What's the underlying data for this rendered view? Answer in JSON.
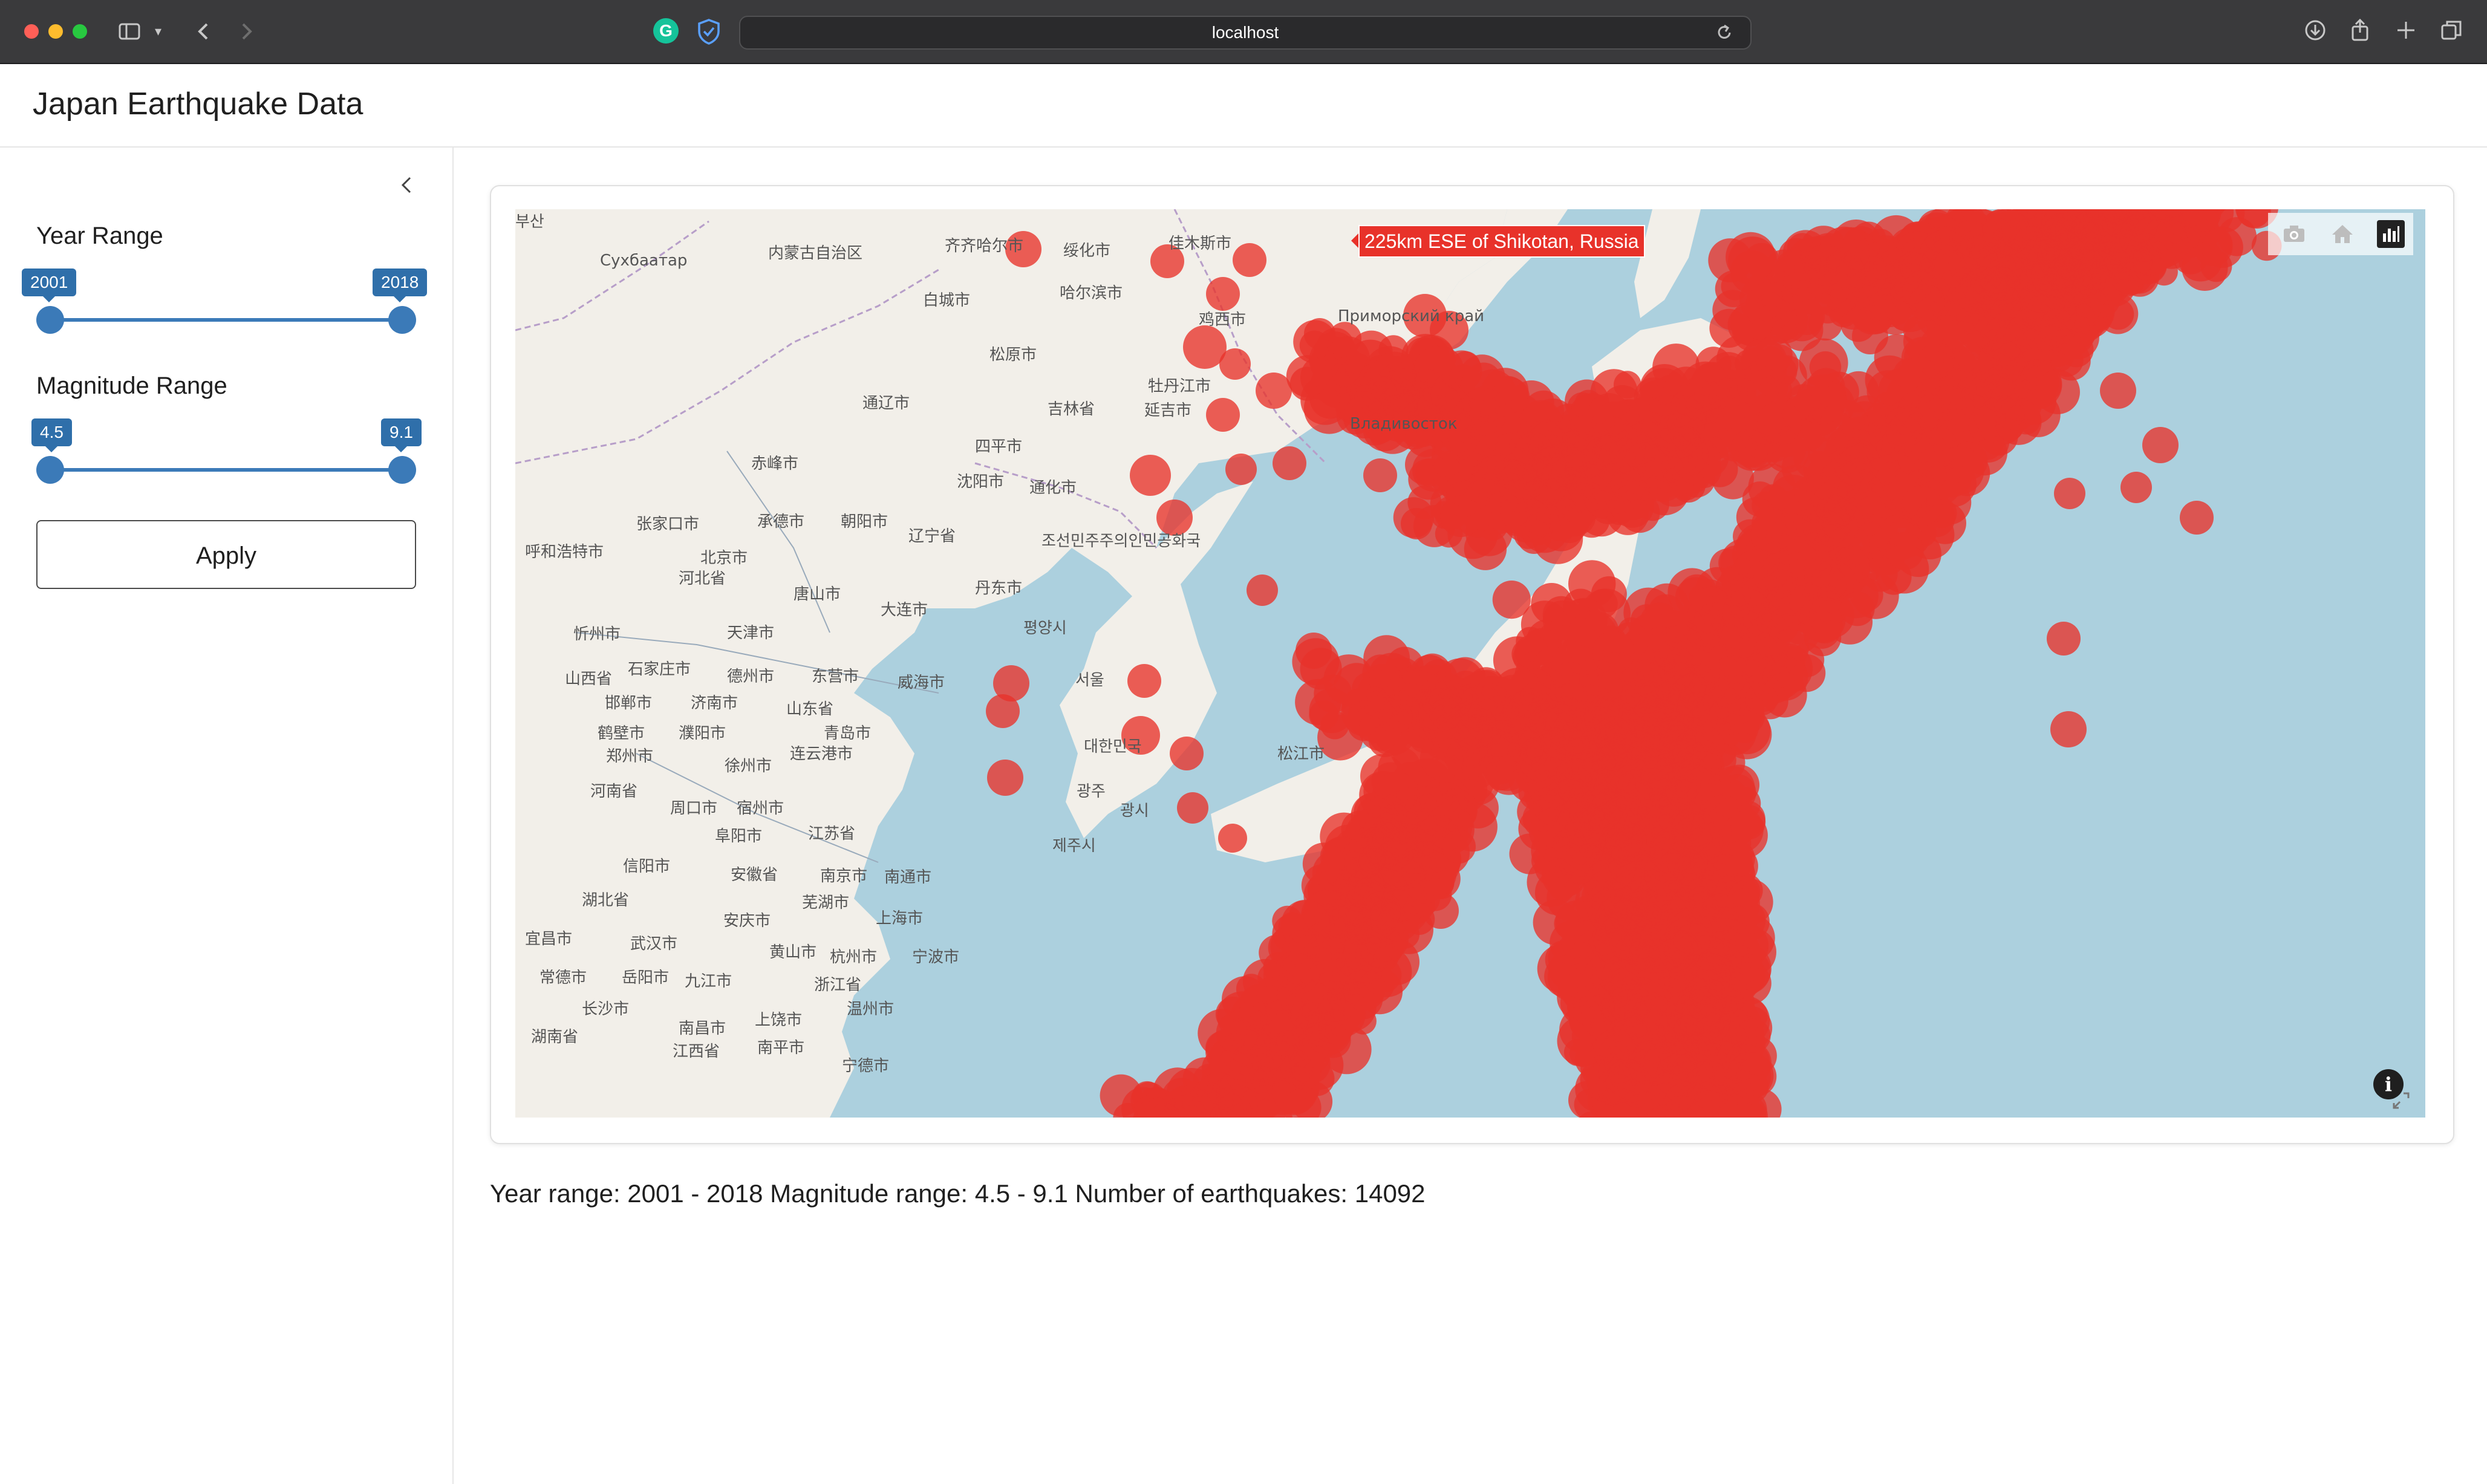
{
  "browser": {
    "url": "localhost",
    "extension_g": "G"
  },
  "app": {
    "title": "Japan Earthquake Data"
  },
  "sidebar": {
    "year_range": {
      "label": "Year Range",
      "min_label": "2001",
      "max_label": "2018",
      "value_low": 2001,
      "value_high": 2018
    },
    "magnitude_range": {
      "label": "Magnitude Range",
      "min_label": "4.5",
      "max_label": "9.1",
      "value_low": 4.5,
      "value_high": 9.1
    },
    "apply_label": "Apply"
  },
  "map": {
    "marker_color": "#e8322a",
    "ocean_color": "#acd0de",
    "land_color": "#f2efe9",
    "tooltip": "225km ESE of Shikotan, Russia",
    "info_glyph": "i",
    "place_labels": [
      {
        "text": "齐齐哈尔市"
      },
      {
        "text": "绥化市"
      },
      {
        "text": "佳木斯市"
      },
      {
        "text": "哈尔滨市"
      },
      {
        "text": "白城市"
      },
      {
        "text": "松原市"
      },
      {
        "text": "鸡西市"
      },
      {
        "text": "Приморский край"
      },
      {
        "text": "牡丹江市"
      },
      {
        "text": "延吉市"
      },
      {
        "text": "通辽市"
      },
      {
        "text": "四平市"
      },
      {
        "text": "赤峰市"
      },
      {
        "text": "沈阳市"
      },
      {
        "text": "通化市"
      },
      {
        "text": "张家口市"
      },
      {
        "text": "承德市"
      },
      {
        "text": "朝阳市"
      },
      {
        "text": "辽宁省"
      },
      {
        "text": "조선민주주의인민공화국"
      },
      {
        "text": "呼和浩特市"
      },
      {
        "text": "北京市"
      },
      {
        "text": "丹东市"
      },
      {
        "text": "河北省"
      },
      {
        "text": "唐山市"
      },
      {
        "text": "大连市"
      },
      {
        "text": "평양시"
      },
      {
        "text": "忻州市"
      },
      {
        "text": "天津市"
      },
      {
        "text": "石家庄市"
      },
      {
        "text": "德州市"
      },
      {
        "text": "东营市"
      },
      {
        "text": "威海市"
      },
      {
        "text": "서울"
      },
      {
        "text": "山西省"
      },
      {
        "text": "邯郸市"
      },
      {
        "text": "济南市"
      },
      {
        "text": "山东省"
      },
      {
        "text": "鹤壁市"
      },
      {
        "text": "濮阳市"
      },
      {
        "text": "青岛市"
      },
      {
        "text": "대한민국"
      },
      {
        "text": "郑州市"
      },
      {
        "text": "连云港市"
      },
      {
        "text": "徐州市"
      },
      {
        "text": "광주"
      },
      {
        "text": "河南省"
      },
      {
        "text": "周口市"
      },
      {
        "text": "宿州市"
      },
      {
        "text": "阜阳市"
      },
      {
        "text": "江苏省"
      },
      {
        "text": "제주시"
      },
      {
        "text": "信阳市"
      },
      {
        "text": "安徽省"
      },
      {
        "text": "南京市"
      },
      {
        "text": "南通市"
      },
      {
        "text": "湖北省"
      },
      {
        "text": "芜湖市"
      },
      {
        "text": "安庆市"
      },
      {
        "text": "上海市"
      },
      {
        "text": "宜昌市"
      },
      {
        "text": "武汉市"
      },
      {
        "text": "黄山市"
      },
      {
        "text": "杭州市"
      },
      {
        "text": "宁波市"
      },
      {
        "text": "常德市"
      },
      {
        "text": "岳阳市"
      },
      {
        "text": "九江市"
      },
      {
        "text": "浙江省"
      },
      {
        "text": "长沙市"
      },
      {
        "text": "上饶市"
      },
      {
        "text": "温州市"
      },
      {
        "text": "南昌市"
      },
      {
        "text": "南平市"
      },
      {
        "text": "湖南省"
      },
      {
        "text": "江西省"
      },
      {
        "text": "宁德市"
      },
      {
        "text": "Сухбаатар"
      },
      {
        "text": "内蒙古自治区"
      },
      {
        "text": "吉林省"
      },
      {
        "text": "Владивосток"
      },
      {
        "text": "松江市"
      },
      {
        "text": "광시"
      },
      {
        "text": "부산"
      }
    ]
  },
  "summary": "Year range: 2001 - 2018 Magnitude range: 4.5 - 9.1 Number of earthquakes: 14092"
}
